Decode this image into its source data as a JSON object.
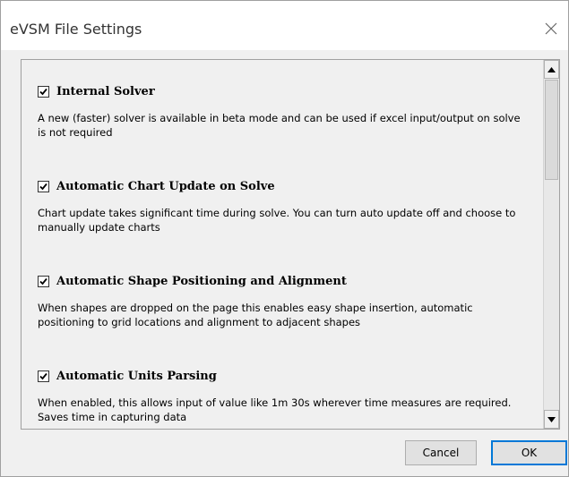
{
  "dialog": {
    "title": "eVSM File Settings",
    "close_icon": "close-x-icon"
  },
  "settings": [
    {
      "label": "Internal Solver",
      "checked": true,
      "description": "A new (faster) solver is available in beta mode and can be used if excel input/output on solve is not required"
    },
    {
      "label": "Automatic Chart Update on Solve",
      "checked": true,
      "description": "Chart update takes significant time during solve. You can turn auto update off and choose to manually update charts"
    },
    {
      "label": "Automatic Shape Positioning and Alignment",
      "checked": true,
      "description": "When shapes are dropped on the page this enables easy shape insertion, automatic positioning to grid locations and alignment to adjacent shapes"
    },
    {
      "label": "Automatic Units Parsing",
      "checked": true,
      "description": "When enabled, this allows input of value like 1m 30s wherever time measures are required. Saves time in capturing data"
    }
  ],
  "buttons": {
    "cancel": "Cancel",
    "ok": "OK"
  },
  "scrollbar": {
    "up_icon": "scroll-up-arrow-icon",
    "down_icon": "scroll-down-arrow-icon"
  }
}
